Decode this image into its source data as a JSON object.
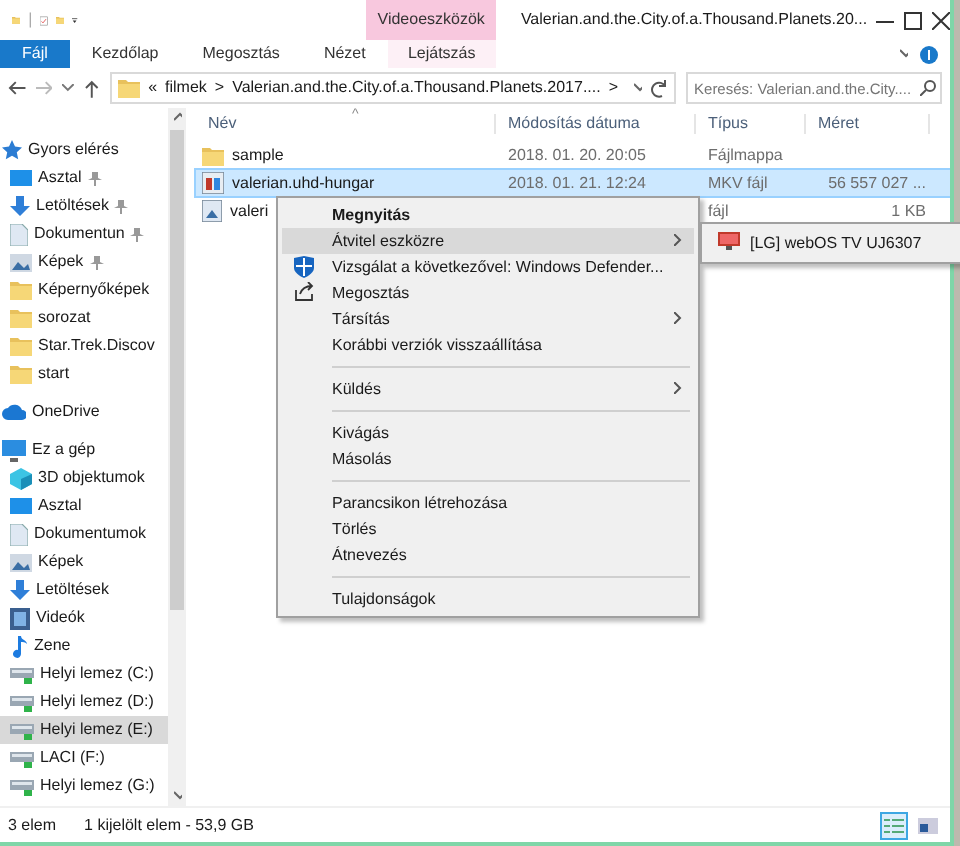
{
  "quick_access_toolbar": {
    "separator": "|"
  },
  "context_tab": {
    "label": "Videoeszközök"
  },
  "window": {
    "title": "Valerian.and.the.City.of.a.Thousand.Planets.20..."
  },
  "ribbon_tabs": [
    {
      "label": "Fájl",
      "kind": "file"
    },
    {
      "label": "Kezdőlap",
      "kind": "tab"
    },
    {
      "label": "Megosztás",
      "kind": "tab"
    },
    {
      "label": "Nézet",
      "kind": "tab"
    },
    {
      "label": "Lejátszás",
      "kind": "context"
    }
  ],
  "address_bar": {
    "overflow": "«",
    "path": [
      "filmek",
      "Valerian.and.the.City.of.a.Thousand.Planets.2017...."
    ],
    "separator": ">"
  },
  "search": {
    "placeholder": "Keresés: Valerian.and.the.City...."
  },
  "sidebar": [
    {
      "label": "Gyors elérés",
      "kind": "star",
      "selected": false,
      "children": [
        {
          "label": "Asztal",
          "kind": "desktop",
          "pinned": true,
          "selected": false
        },
        {
          "label": "Letöltések",
          "kind": "download",
          "pinned": true,
          "selected": false
        },
        {
          "label": "Dokumentun",
          "kind": "document",
          "pinned": true,
          "selected": false
        },
        {
          "label": "Képek",
          "kind": "pictures",
          "pinned": true,
          "selected": false
        },
        {
          "label": "Képernyőképek",
          "kind": "folder",
          "pinned": false,
          "selected": false
        },
        {
          "label": "sorozat",
          "kind": "folder",
          "pinned": false,
          "selected": false
        },
        {
          "label": "Star.Trek.Discov",
          "kind": "folder",
          "pinned": false,
          "selected": false
        },
        {
          "label": "start",
          "kind": "folder",
          "pinned": false,
          "selected": false
        }
      ]
    },
    {
      "label": "OneDrive",
      "kind": "cloud",
      "selected": false
    },
    {
      "label": "Ez a gép",
      "kind": "pc",
      "selected": false,
      "children": [
        {
          "label": "3D objektumok",
          "kind": "cube",
          "pinned": false,
          "selected": false
        },
        {
          "label": "Asztal",
          "kind": "desktop",
          "pinned": false,
          "selected": false
        },
        {
          "label": "Dokumentumok",
          "kind": "document",
          "pinned": false,
          "selected": false
        },
        {
          "label": "Képek",
          "kind": "pictures",
          "pinned": false,
          "selected": false
        },
        {
          "label": "Letöltések",
          "kind": "download",
          "pinned": false,
          "selected": false
        },
        {
          "label": "Videók",
          "kind": "video",
          "pinned": false,
          "selected": false
        },
        {
          "label": "Zene",
          "kind": "music",
          "pinned": false,
          "selected": false
        },
        {
          "label": "Helyi lemez (C:)",
          "kind": "drive",
          "pinned": false,
          "selected": false
        },
        {
          "label": "Helyi lemez (D:)",
          "kind": "drive",
          "pinned": false,
          "selected": false
        },
        {
          "label": "Helyi lemez (E:)",
          "kind": "drive",
          "pinned": false,
          "selected": true
        },
        {
          "label": "LACI (F:)",
          "kind": "drive",
          "pinned": false,
          "selected": false
        },
        {
          "label": "Helyi lemez (G:)",
          "kind": "drive",
          "pinned": false,
          "selected": false
        }
      ]
    }
  ],
  "table": {
    "sort_indicator": "^",
    "columns": [
      "Név",
      "Módosítás dátuma",
      "Típus",
      "Méret"
    ],
    "rows": [
      {
        "kind": "folder",
        "name": "sample",
        "date": "2018. 01. 20. 20:05",
        "type": "Fájlmappa",
        "selected": false
      },
      {
        "kind": "video",
        "name": "valerian.uhd-hungar",
        "date": "2018. 01. 21. 12:24",
        "type": "MKV fájl",
        "size": "56 557 027 ...",
        "selected": true
      },
      {
        "kind": "image",
        "name": "valeri",
        "type": "fájl",
        "size": "1 KB",
        "selected": false
      }
    ]
  },
  "context_menu": [
    {
      "kind": "command",
      "label": "Megnyitás",
      "default": true,
      "submenu": false,
      "selected": false
    },
    {
      "kind": "command",
      "label": "Átvitel eszközre",
      "default": false,
      "submenu": true,
      "selected": true
    },
    {
      "kind": "scan",
      "label": "Vizsgálat a következővel: Windows Defender...",
      "default": false,
      "submenu": false,
      "selected": false
    },
    {
      "kind": "share",
      "label": "Megosztás",
      "default": false,
      "submenu": false,
      "selected": false
    },
    {
      "kind": "command",
      "label": "Társítás",
      "default": false,
      "submenu": true,
      "selected": false
    },
    {
      "kind": "command",
      "label": "Korábbi verziók visszaállítása",
      "default": false,
      "submenu": false,
      "selected": false
    },
    {
      "kind": "separator"
    },
    {
      "kind": "command",
      "label": "Küldés",
      "default": false,
      "submenu": true,
      "selected": false
    },
    {
      "kind": "separator"
    },
    {
      "kind": "command",
      "label": "Kivágás",
      "default": false,
      "submenu": false,
      "selected": false
    },
    {
      "kind": "command",
      "label": "Másolás",
      "default": false,
      "submenu": false,
      "selected": false
    },
    {
      "kind": "separator"
    },
    {
      "kind": "command",
      "label": "Parancsikon létrehozása",
      "default": false,
      "submenu": false,
      "selected": false
    },
    {
      "kind": "command",
      "label": "Törlés",
      "default": false,
      "submenu": false,
      "selected": false
    },
    {
      "kind": "command",
      "label": "Átnevezés",
      "default": false,
      "submenu": false,
      "selected": false
    },
    {
      "kind": "separator"
    },
    {
      "kind": "command",
      "label": "Tulajdonságok",
      "default": false,
      "submenu": false,
      "selected": false
    }
  ],
  "submenu": [
    {
      "kind": "tv",
      "label": "[LG] webOS TV UJ6307",
      "selected": false
    }
  ],
  "status_bar": {
    "item_count": "3 elem",
    "selection": "1 kijelölt elem - 53,9 GB",
    "views": [
      {
        "kind": "details",
        "selected": true
      },
      {
        "kind": "large_icons",
        "selected": false
      }
    ]
  }
}
